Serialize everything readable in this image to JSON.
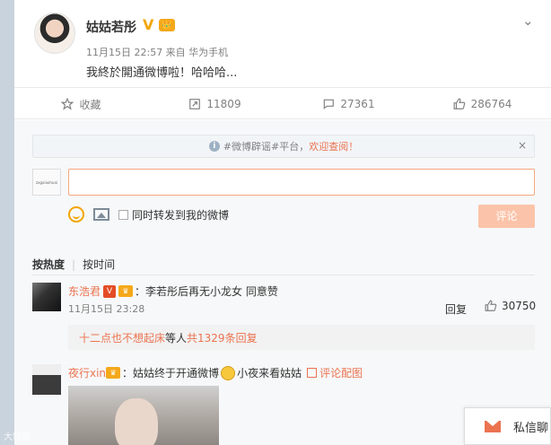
{
  "post": {
    "author": "姑姑若彤",
    "verified_badge": "V",
    "member_badge": "👑",
    "meta": "11月15日 22:57 来自 华为手机",
    "text": "我終於開通微博啦！哈哈哈...",
    "more_icon": "chevron-down-icon"
  },
  "actions": {
    "favorite_label": "收藏",
    "forward_count": "11809",
    "comment_count": "27361",
    "like_count": "286764"
  },
  "notice": {
    "prefix": "#微博辟谣#平台，",
    "link": "欢迎查阅！",
    "close": "×"
  },
  "composer": {
    "avatar_text": "zxgxiaohuai",
    "input_value": "",
    "forward_option": "同时转发到我的微博",
    "submit_label": "评论"
  },
  "sort": {
    "by_hot": "按热度",
    "by_time": "按时间"
  },
  "comments": [
    {
      "user": "东浩君",
      "vip": "V",
      "text": "：李若彤后再无小龙女 同意赞",
      "time": "11月15日 23:28",
      "reply_label": "回复",
      "likes": "30750",
      "sub_user": "十二点也不想起床",
      "sub_mid": " 等人 ",
      "sub_link": "共1329条回复"
    },
    {
      "user": "夜行xin",
      "text_a": "：姑姑终于开通微博",
      "text_b": "小夜来看姑姑",
      "pic_link": "评论配图"
    }
  ],
  "private_message": {
    "label": "私信聊"
  },
  "watermark": "大数据"
}
